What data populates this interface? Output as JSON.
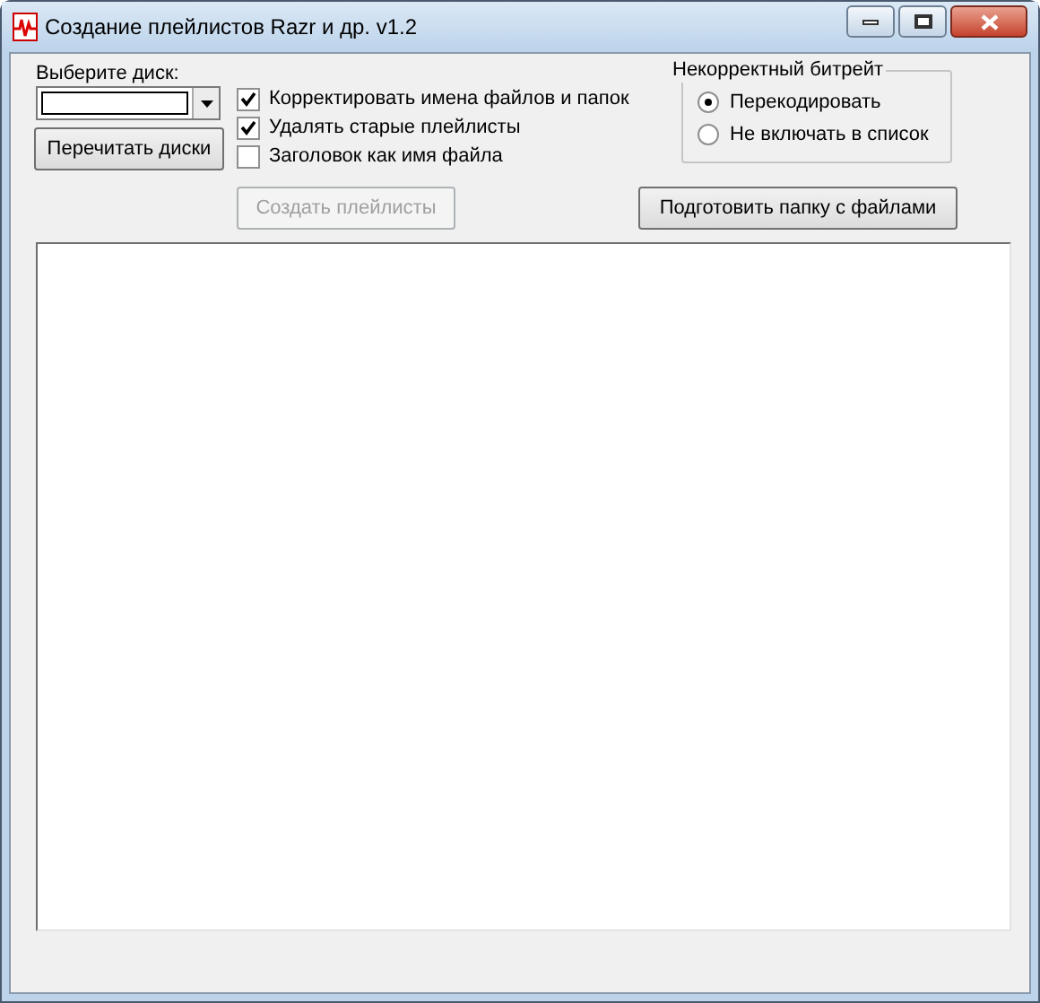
{
  "window": {
    "title": "Создание плейлистов Razr и др. v1.2"
  },
  "drive": {
    "label": "Выберите диск:"
  },
  "reread_button": {
    "label": "Перечитать диски",
    "disabled": false
  },
  "options": [
    {
      "label": "Корректировать имена файлов и папок",
      "checked": true
    },
    {
      "label": "Удалять старые плейлисты",
      "checked": true
    },
    {
      "label": "Заголовок как имя файла",
      "checked": false
    }
  ],
  "bitrate_group": {
    "title": "Некорректный битрейт",
    "options": [
      {
        "label": "Перекодировать",
        "selected": true
      },
      {
        "label": "Не включать в список",
        "selected": false
      }
    ]
  },
  "create_button": {
    "label": "Создать плейлисты",
    "disabled": true
  },
  "prepare_button": {
    "label": "Подготовить папку с файлами",
    "disabled": false
  }
}
